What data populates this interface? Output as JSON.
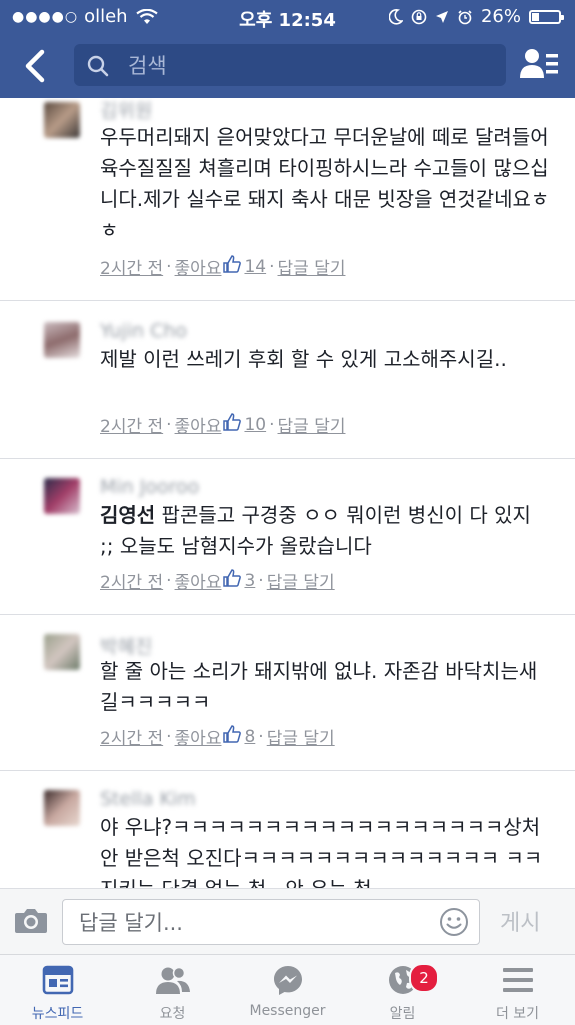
{
  "status_bar": {
    "signal_dots": "●●●●○",
    "carrier": "olleh",
    "time": "오후 12:54",
    "battery": "26%",
    "battery_level": 0.26
  },
  "header": {
    "search_placeholder": "검색",
    "background": "#3b5998"
  },
  "comments": [
    {
      "name": "김위원",
      "text": "우두머리돼지 읃어맞았다고 무더운날에 떼로 달려들어 육수질질질 쳐흘리며 타이핑하시느라 수고들이  많으십니다.제가 실수로 돼지 축사 대문 빗장을 연것같네요ㅎㅎ",
      "time": "2시간 전",
      "like": "좋아요",
      "likes": "14",
      "reply": "답글 달기"
    },
    {
      "name": "Yujin Cho",
      "text": "제발 이런 쓰레기 후회 할 수 있게 고소해주시길..",
      "time": "2시간 전",
      "like": "좋아요",
      "likes": "10",
      "reply": "답글 달기"
    },
    {
      "name": "Min Jooroo",
      "tag": "김영선",
      "text": " 팝콘들고 구경중 ㅇㅇ 뭐이런 병신이 다 있지 ;; 오늘도 남혐지수가 올랐습니다",
      "time": "2시간 전",
      "like": "좋아요",
      "likes": "3",
      "reply": "답글 달기"
    },
    {
      "name": "박혜진",
      "text": "할 줄 아는 소리가 돼지밖에 없냐. 자존감 바닥치는새길ㅋㅋㅋㅋㅋ",
      "time": "2시간 전",
      "like": "좋아요",
      "likes": "8",
      "reply": "답글 달기"
    },
    {
      "name": "Stella Kim",
      "text": "야 우냐?ㅋㅋㅋㅋㅋㅋㅋㅋㅋㅋㅋㅋㅋㅋㅋㅋㅋㅋ상처 안 받은척 오진다ㅋㅋㅋㅋㅋㅋㅋㅋㅋㅋㅋㅋㅋㅋ ㅋㅋ 지키는 단결 없는 척 ..안 우는 척"
    }
  ],
  "composer": {
    "placeholder": "답글 달기...",
    "post_label": "게시"
  },
  "tabs": [
    {
      "label": "뉴스피드",
      "icon": "news-feed-icon"
    },
    {
      "label": "요청",
      "icon": "friend-requests-icon"
    },
    {
      "label": "Messenger",
      "icon": "messenger-icon"
    },
    {
      "label": "알림",
      "icon": "globe-icon",
      "badge": "2"
    },
    {
      "label": "더 보기",
      "icon": "menu-icon"
    }
  ],
  "colors": {
    "accent": "#4267b2",
    "badge": "#e41e3f",
    "like": "#4267b2"
  }
}
